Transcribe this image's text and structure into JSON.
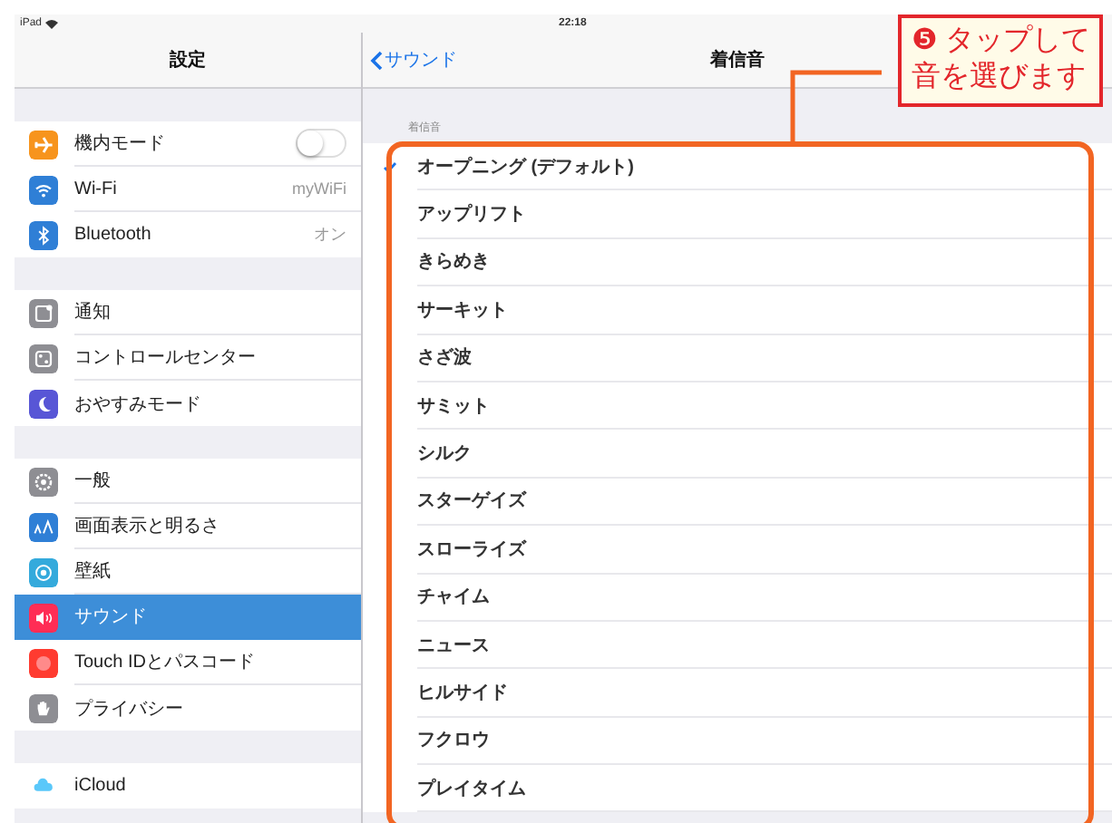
{
  "status_bar": {
    "device": "iPad",
    "time": "22:18"
  },
  "settings": {
    "title": "設定",
    "groups": [
      {
        "items": [
          {
            "label": "機内モード",
            "kind": "toggle",
            "on": false,
            "selected": false
          },
          {
            "label": "Wi-Fi",
            "kind": "value",
            "value": "myWiFi",
            "selected": false
          },
          {
            "label": "Bluetooth",
            "kind": "value",
            "value": "オン",
            "selected": false
          }
        ]
      },
      {
        "items": [
          {
            "label": "通知",
            "kind": "plain",
            "selected": false
          },
          {
            "label": "コントロールセンター",
            "kind": "plain",
            "selected": false
          },
          {
            "label": "おやすみモード",
            "kind": "plain",
            "selected": false
          }
        ]
      },
      {
        "items": [
          {
            "label": "一般",
            "kind": "plain",
            "selected": false
          },
          {
            "label": "画面表示と明るさ",
            "kind": "plain",
            "selected": false
          },
          {
            "label": "壁紙",
            "kind": "plain",
            "selected": false
          },
          {
            "label": "サウンド",
            "kind": "plain",
            "selected": true
          },
          {
            "label": "Touch IDとパスコード",
            "kind": "plain",
            "selected": false
          },
          {
            "label": "プライバシー",
            "kind": "plain",
            "selected": false
          }
        ]
      },
      {
        "items": [
          {
            "label": "iCloud",
            "kind": "plain",
            "selected": false
          }
        ]
      }
    ]
  },
  "detail": {
    "back": "サウンド",
    "title": "着信音",
    "section_header": "着信音",
    "tones": [
      {
        "name": "オープニング (デフォルト)",
        "selected": true
      },
      {
        "name": "アップリフト",
        "selected": false
      },
      {
        "name": "きらめき",
        "selected": false
      },
      {
        "name": "サーキット",
        "selected": false
      },
      {
        "name": "さざ波",
        "selected": false
      },
      {
        "name": "サミット",
        "selected": false
      },
      {
        "name": "シルク",
        "selected": false
      },
      {
        "name": "スターゲイズ",
        "selected": false
      },
      {
        "name": "スローライズ",
        "selected": false
      },
      {
        "name": "チャイム",
        "selected": false
      },
      {
        "name": "ニュース",
        "selected": false
      },
      {
        "name": "ヒルサイド",
        "selected": false
      },
      {
        "name": "フクロウ",
        "selected": false
      },
      {
        "name": "プレイタイム",
        "selected": false
      }
    ]
  },
  "callout": {
    "number": "❺",
    "lines": [
      "タップして",
      "音を選びます"
    ]
  }
}
